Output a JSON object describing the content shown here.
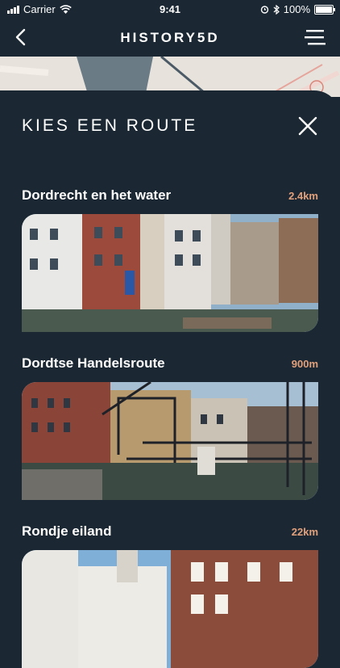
{
  "status": {
    "carrier": "Carrier",
    "time": "9:41",
    "battery": "100%"
  },
  "header": {
    "title": "HISTORY5D"
  },
  "panel": {
    "title": "KIES EEN ROUTE"
  },
  "routes": [
    {
      "name": "Dordrecht en het water",
      "distance": "2.4km"
    },
    {
      "name": "Dordtse Handelsroute",
      "distance": "900m"
    },
    {
      "name": "Rondje eiland",
      "distance": "22km"
    }
  ],
  "colors": {
    "background": "#1b2834",
    "accent": "#e2a07b",
    "text": "#ffffff"
  },
  "icons": [
    "back-icon",
    "menu-icon",
    "close-icon",
    "wifi-icon",
    "alarm-icon",
    "bluetooth-icon",
    "battery-icon"
  ]
}
